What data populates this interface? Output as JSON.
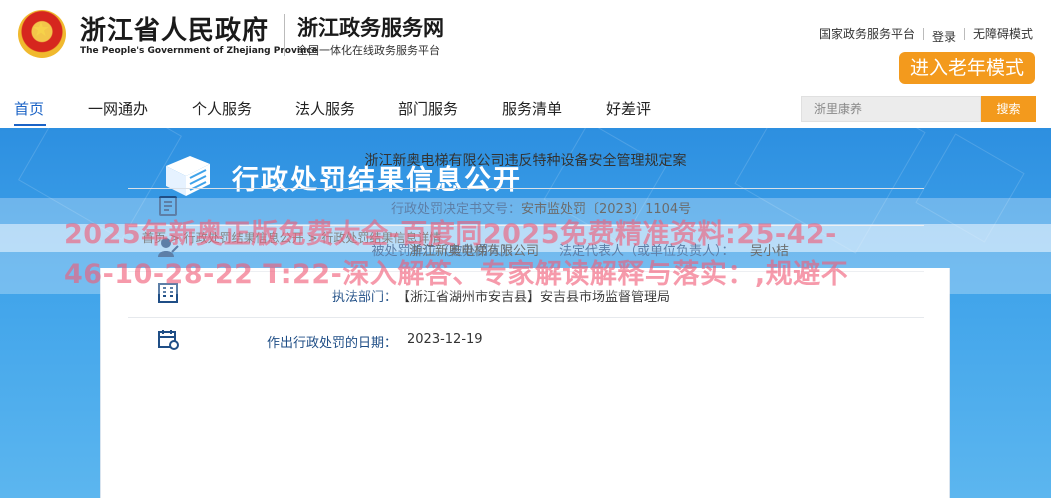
{
  "header": {
    "gov_title": "浙江省人民政府",
    "gov_subtitle": "The People's Government of Zhejiang Province",
    "svc_title": "浙江政务服务网",
    "svc_subtitle": "全国一体化在线政务服务平台",
    "links": [
      "国家政务服务平台",
      "登录",
      "无障碍模式"
    ],
    "elder_mode": "进入老年模式"
  },
  "nav": {
    "items": [
      "首页",
      "一网通办",
      "个人服务",
      "法人服务",
      "部门服务",
      "服务清单",
      "好差评"
    ],
    "active": "首页"
  },
  "search": {
    "placeholder": "浙里康养",
    "button": "搜索"
  },
  "banner": {
    "title": "行政处罚结果信息公开"
  },
  "breadcrumb": "首页 > 行政处罚结果信息公开 > 行政处罚结果信息详情",
  "case_title": "浙江新奥电梯有限公司违反特种设备安全管理规定案",
  "rows": [
    {
      "icon": "document-icon",
      "label": "行政处罚决定书文号：",
      "value": "安市监处罚〔2023〕1104号"
    },
    {
      "icon": "person-icon",
      "label": "被处罚单位（被处罚人）：",
      "value": "浙江新奥电梯有限公司",
      "label2": "法定代表人（或单位负责人）：",
      "value2": "吴小桔"
    },
    {
      "icon": "building-icon",
      "label": "执法部门：",
      "value": "【浙江省湖州市安吉县】安吉县市场监督管理局"
    },
    {
      "icon": "calendar-icon",
      "label": "作出行政处罚的日期：",
      "value": "2023-12-19"
    }
  ],
  "watermark": {
    "line1": "2025年新奥正版免费大全-百度同2025免费精准资料:25-42-",
    "line2": "46-10-28-22 T:22-深入解答、专家解读解释与落实：,规避不"
  },
  "colors": {
    "accent_blue": "#1b63c6",
    "orange": "#f39a1d",
    "banner_blue": "#3fa3ea",
    "label_blue": "#1f4e86"
  }
}
